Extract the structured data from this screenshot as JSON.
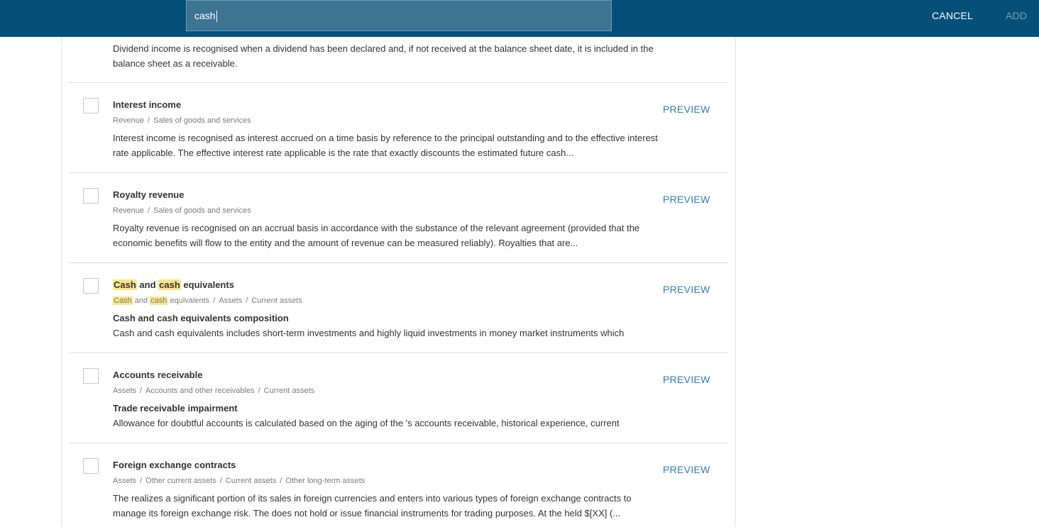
{
  "search": {
    "value": "cash"
  },
  "header": {
    "cancel_label": "CANCEL",
    "add_label": "ADD"
  },
  "items": [
    {
      "desc": "Dividend income is recognised when a dividend has been declared and, if not received at the balance sheet date, it is included in the balance sheet as a receivable."
    },
    {
      "title": "Interest income",
      "crumbs": [
        "Revenue",
        "Sales of goods and services"
      ],
      "desc": "Interest income is recognised as interest accrued on a time basis by reference to the principal outstanding and to the effective interest rate applicable. The effective interest rate applicable is the rate that exactly discounts the estimated future cash...",
      "preview": "PREVIEW"
    },
    {
      "title": "Royalty revenue",
      "crumbs": [
        "Revenue",
        "Sales of goods and services"
      ],
      "desc": "Royalty revenue is recognised on an accrual basis in accordance with the substance of the relevant agreement (provided that the economic benefits will flow to the entity and the amount of revenue can be measured reliably). Royalties that are...",
      "preview": "PREVIEW"
    },
    {
      "title_parts": [
        "Cash",
        " and ",
        "cash",
        " equivalents"
      ],
      "crumb_first_parts": [
        "Cash",
        " and ",
        "cash",
        " equivalents"
      ],
      "crumbs_rest": [
        "Assets",
        "Current assets"
      ],
      "subhead": "Cash and cash equivalents composition",
      "desc": "Cash and cash equivalents includes short-term investments and highly liquid investments in money market instruments which",
      "preview": "PREVIEW"
    },
    {
      "title": "Accounts receivable",
      "crumbs": [
        "Assets",
        "Accounts and other receivables",
        "Current assets"
      ],
      "subhead": "Trade receivable impairment",
      "desc": "Allowance for doubtful accounts is calculated based on the aging of the 's accounts receivable, historical experience, current",
      "preview": "PREVIEW"
    },
    {
      "title": "Foreign exchange contracts",
      "crumbs": [
        "Assets",
        "Other current assets",
        "Current assets",
        "Other long-term assets"
      ],
      "desc": "The realizes a significant portion of its sales in foreign currencies and enters into various types of foreign exchange contracts to manage its foreign exchange risk. The does not hold or issue financial instruments for trading purposes. At  the held $[XX] (...",
      "preview": "PREVIEW"
    }
  ],
  "separator": "/",
  "colors": {
    "header_bg": "#055079",
    "link": "#2b7fb8",
    "highlight": "#fce58a"
  }
}
